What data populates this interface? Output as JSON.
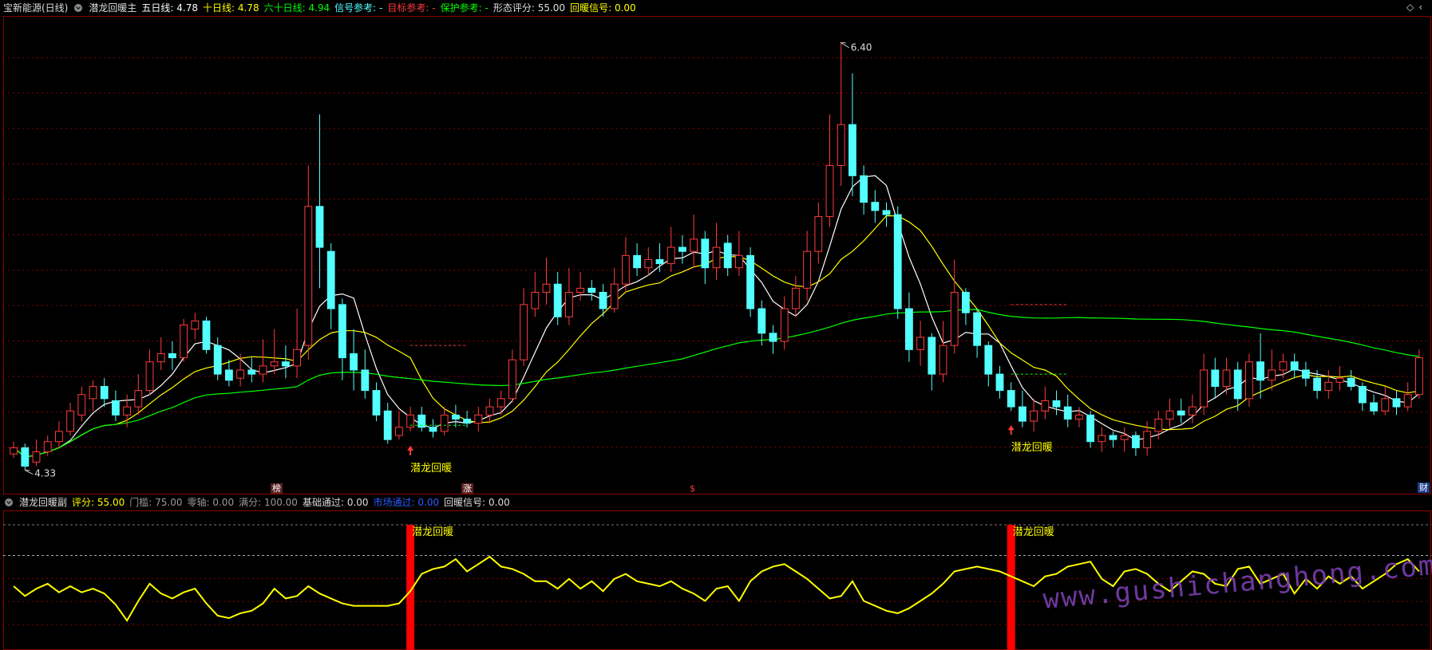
{
  "main_header": {
    "stock": "宝新能源(日线)",
    "indicator": "潜龙回暖主",
    "ma5_label": "五日线:",
    "ma5_value": "4.78",
    "ma10_label": "十日线:",
    "ma10_value": "4.78",
    "ma60_label": "六十日线:",
    "ma60_value": "4.94",
    "signal_ref_label": "信号参考:",
    "signal_ref_value": "-",
    "target_ref_label": "目标参考:",
    "target_ref_value": "-",
    "protect_ref_label": "保护参考:",
    "protect_ref_value": "-",
    "score_label": "形态评分:",
    "score_value": "55.00",
    "signal_label": "回暖信号:",
    "signal_value": "0.00"
  },
  "sub_header": {
    "indicator": "潜龙回暖副",
    "score_label": "评分:",
    "score_value": "55.00",
    "threshold_label": "门槛:",
    "threshold_value": "75.00",
    "zero_label": "零轴:",
    "zero_value": "0.00",
    "full_label": "满分:",
    "full_value": "100.00",
    "basic_label": "基础通过:",
    "basic_value": "0.00",
    "market_label": "市场通过:",
    "market_value": "0.00",
    "signal_label": "回暖信号:",
    "signal_value": "0.00"
  },
  "markers": {
    "bang": "榜",
    "zhang": "涨",
    "s": "$",
    "cai": "财"
  },
  "watermark": "www.gushichanghong.com",
  "colors": {
    "up": "#ff3b3b",
    "down": "#54ffff",
    "ma5": "#ffffff",
    "ma10": "#ffff00",
    "ma60": "#00ff00",
    "grid": "#8b0000",
    "osc": "#ffff00",
    "signal_bar": "#ff0000",
    "label_yellow": "#ffff00"
  },
  "chart_data": [
    {
      "type": "candlestick",
      "title": "宝新能源(日线)",
      "ylim": [
        4.25,
        6.5
      ],
      "price_labels": [
        "6.40",
        "4.33"
      ],
      "high_price": 6.4,
      "low_price": 4.33,
      "signal_label": "潜龙回暖",
      "signals": [
        {
          "index": 35,
          "label": "潜龙回暖",
          "target": 4.92,
          "protect": 4.53
        },
        {
          "index": 88,
          "label": "潜龙回暖",
          "target": 5.12,
          "protect": 4.78
        }
      ],
      "candles": [
        [
          4.39,
          4.42,
          4.37,
          4.45
        ],
        [
          4.42,
          4.33,
          4.31,
          4.44
        ],
        [
          4.35,
          4.4,
          4.33,
          4.46
        ],
        [
          4.4,
          4.45,
          4.38,
          4.48
        ],
        [
          4.45,
          4.5,
          4.42,
          4.55
        ],
        [
          4.5,
          4.6,
          4.48,
          4.64
        ],
        [
          4.58,
          4.68,
          4.55,
          4.72
        ],
        [
          4.66,
          4.72,
          4.6,
          4.75
        ],
        [
          4.72,
          4.66,
          4.62,
          4.76
        ],
        [
          4.65,
          4.58,
          4.55,
          4.7
        ],
        [
          4.58,
          4.62,
          4.52,
          4.68
        ],
        [
          4.62,
          4.7,
          4.58,
          4.78
        ],
        [
          4.7,
          4.84,
          4.68,
          4.9
        ],
        [
          4.84,
          4.88,
          4.8,
          4.96
        ],
        [
          4.88,
          4.86,
          4.8,
          4.94
        ],
        [
          4.86,
          5.02,
          4.84,
          5.05
        ],
        [
          5.0,
          5.04,
          4.95,
          5.08
        ],
        [
          5.04,
          4.9,
          4.88,
          5.06
        ],
        [
          4.92,
          4.78,
          4.75,
          4.96
        ],
        [
          4.8,
          4.75,
          4.72,
          4.85
        ],
        [
          4.76,
          4.8,
          4.72,
          4.88
        ],
        [
          4.8,
          4.78,
          4.74,
          4.86
        ],
        [
          4.78,
          4.82,
          4.74,
          4.95
        ],
        [
          4.82,
          4.84,
          4.78,
          5.0
        ],
        [
          4.84,
          4.82,
          4.76,
          4.92
        ],
        [
          4.82,
          4.9,
          4.76,
          5.1
        ],
        [
          4.92,
          5.6,
          4.85,
          5.8
        ],
        [
          5.6,
          5.4,
          5.2,
          6.05
        ],
        [
          5.38,
          5.1,
          5.0,
          5.42
        ],
        [
          5.12,
          4.86,
          4.75,
          5.15
        ],
        [
          4.88,
          4.8,
          4.7,
          5.0
        ],
        [
          4.8,
          4.7,
          4.66,
          4.9
        ],
        [
          4.7,
          4.58,
          4.55,
          4.74
        ],
        [
          4.6,
          4.46,
          4.44,
          4.64
        ],
        [
          4.48,
          4.52,
          4.46,
          4.6
        ],
        [
          4.52,
          4.58,
          4.5,
          4.62
        ],
        [
          4.58,
          4.52,
          4.5,
          4.62
        ],
        [
          4.52,
          4.5,
          4.47,
          4.56
        ],
        [
          4.5,
          4.58,
          4.48,
          4.62
        ],
        [
          4.58,
          4.56,
          4.52,
          4.63
        ],
        [
          4.56,
          4.54,
          4.52,
          4.6
        ],
        [
          4.54,
          4.58,
          4.5,
          4.62
        ],
        [
          4.58,
          4.62,
          4.54,
          4.66
        ],
        [
          4.62,
          4.66,
          4.58,
          4.7
        ],
        [
          4.66,
          4.85,
          4.64,
          4.9
        ],
        [
          4.85,
          5.12,
          4.82,
          5.2
        ],
        [
          5.1,
          5.18,
          5.06,
          5.28
        ],
        [
          5.18,
          5.22,
          5.12,
          5.35
        ],
        [
          5.22,
          5.06,
          5.02,
          5.28
        ],
        [
          5.06,
          5.18,
          5.02,
          5.3
        ],
        [
          5.18,
          5.2,
          5.14,
          5.28
        ],
        [
          5.2,
          5.18,
          5.14,
          5.24
        ],
        [
          5.18,
          5.1,
          5.06,
          5.22
        ],
        [
          5.1,
          5.22,
          5.08,
          5.3
        ],
        [
          5.22,
          5.36,
          5.18,
          5.45
        ],
        [
          5.36,
          5.3,
          5.26,
          5.42
        ],
        [
          5.3,
          5.34,
          5.26,
          5.4
        ],
        [
          5.34,
          5.32,
          5.28,
          5.42
        ],
        [
          5.32,
          5.4,
          5.28,
          5.5
        ],
        [
          5.4,
          5.38,
          5.32,
          5.46
        ],
        [
          5.38,
          5.44,
          5.3,
          5.56
        ],
        [
          5.44,
          5.3,
          5.22,
          5.48
        ],
        [
          5.3,
          5.4,
          5.24,
          5.52
        ],
        [
          5.42,
          5.3,
          5.26,
          5.46
        ],
        [
          5.3,
          5.36,
          5.26,
          5.48
        ],
        [
          5.36,
          5.1,
          5.06,
          5.4
        ],
        [
          5.1,
          4.98,
          4.92,
          5.14
        ],
        [
          4.98,
          4.94,
          4.88,
          5.02
        ],
        [
          4.94,
          5.1,
          4.9,
          5.16
        ],
        [
          5.1,
          5.2,
          5.06,
          5.26
        ],
        [
          5.2,
          5.38,
          5.14,
          5.48
        ],
        [
          5.38,
          5.55,
          5.32,
          5.62
        ],
        [
          5.55,
          5.8,
          5.5,
          6.05
        ],
        [
          5.8,
          6.0,
          5.7,
          6.4
        ],
        [
          6.0,
          5.75,
          5.65,
          6.25
        ],
        [
          5.75,
          5.62,
          5.56,
          5.8
        ],
        [
          5.62,
          5.58,
          5.52,
          5.68
        ],
        [
          5.58,
          5.56,
          5.5,
          5.62
        ],
        [
          5.56,
          5.1,
          5.05,
          5.6
        ],
        [
          5.1,
          4.9,
          4.84,
          5.18
        ],
        [
          4.9,
          4.96,
          4.82,
          5.04
        ],
        [
          4.96,
          4.78,
          4.7,
          4.98
        ],
        [
          4.78,
          4.92,
          4.74,
          5.04
        ],
        [
          4.92,
          5.18,
          4.88,
          5.34
        ],
        [
          5.18,
          5.08,
          5.02,
          5.2
        ],
        [
          5.08,
          4.92,
          4.86,
          5.1
        ],
        [
          4.92,
          4.78,
          4.72,
          4.94
        ],
        [
          4.78,
          4.7,
          4.66,
          4.82
        ],
        [
          4.7,
          4.62,
          4.6,
          4.74
        ],
        [
          4.62,
          4.55,
          4.52,
          4.7
        ],
        [
          4.55,
          4.6,
          4.5,
          4.66
        ],
        [
          4.6,
          4.65,
          4.56,
          4.72
        ],
        [
          4.65,
          4.62,
          4.58,
          4.7
        ],
        [
          4.62,
          4.56,
          4.52,
          4.68
        ],
        [
          4.56,
          4.58,
          4.52,
          4.62
        ],
        [
          4.58,
          4.45,
          4.42,
          4.6
        ],
        [
          4.45,
          4.48,
          4.4,
          4.52
        ],
        [
          4.48,
          4.46,
          4.42,
          4.5
        ],
        [
          4.46,
          4.48,
          4.4,
          4.52
        ],
        [
          4.48,
          4.42,
          4.38,
          4.5
        ],
        [
          4.42,
          4.5,
          4.38,
          4.55
        ],
        [
          4.5,
          4.56,
          4.46,
          4.6
        ],
        [
          4.56,
          4.6,
          4.52,
          4.66
        ],
        [
          4.6,
          4.58,
          4.54,
          4.66
        ],
        [
          4.58,
          4.62,
          4.54,
          4.68
        ],
        [
          4.62,
          4.8,
          4.58,
          4.88
        ],
        [
          4.8,
          4.72,
          4.66,
          4.86
        ],
        [
          4.72,
          4.8,
          4.68,
          4.86
        ],
        [
          4.8,
          4.66,
          4.6,
          4.84
        ],
        [
          4.66,
          4.84,
          4.62,
          4.88
        ],
        [
          4.84,
          4.75,
          4.66,
          4.98
        ],
        [
          4.75,
          4.8,
          4.7,
          4.9
        ],
        [
          4.8,
          4.84,
          4.76,
          4.88
        ],
        [
          4.84,
          4.8,
          4.76,
          4.88
        ],
        [
          4.8,
          4.76,
          4.72,
          4.84
        ],
        [
          4.76,
          4.7,
          4.66,
          4.8
        ],
        [
          4.7,
          4.74,
          4.66,
          4.8
        ],
        [
          4.74,
          4.76,
          4.7,
          4.82
        ],
        [
          4.76,
          4.72,
          4.7,
          4.8
        ],
        [
          4.72,
          4.64,
          4.6,
          4.74
        ],
        [
          4.64,
          4.6,
          4.58,
          4.68
        ],
        [
          4.6,
          4.66,
          4.58,
          4.72
        ],
        [
          4.66,
          4.62,
          4.58,
          4.7
        ],
        [
          4.62,
          4.68,
          4.6,
          4.74
        ],
        [
          4.68,
          4.86,
          4.66,
          4.9
        ]
      ]
    },
    {
      "type": "line",
      "title": "潜龙回暖副",
      "ylim": [
        0,
        100
      ],
      "threshold": 75,
      "signal_label": "潜龙回暖",
      "signal_indices": [
        35,
        88
      ],
      "values": [
        50,
        42,
        48,
        52,
        45,
        50,
        45,
        48,
        44,
        35,
        22,
        38,
        52,
        44,
        40,
        45,
        48,
        36,
        26,
        24,
        28,
        30,
        36,
        48,
        40,
        42,
        50,
        44,
        40,
        36,
        34,
        34,
        34,
        34,
        36,
        46,
        60,
        64,
        66,
        72,
        62,
        68,
        74,
        66,
        64,
        60,
        54,
        54,
        48,
        56,
        48,
        54,
        46,
        56,
        60,
        54,
        52,
        50,
        54,
        48,
        44,
        38,
        48,
        50,
        38,
        54,
        62,
        66,
        68,
        62,
        56,
        48,
        40,
        42,
        54,
        38,
        34,
        30,
        28,
        32,
        38,
        44,
        52,
        62,
        64,
        66,
        64,
        62,
        58,
        54,
        50,
        58,
        60,
        66,
        68,
        70,
        56,
        50,
        62,
        64,
        60,
        52,
        46,
        54,
        62,
        60,
        52,
        50,
        64,
        66,
        52,
        56,
        60,
        44,
        56,
        48,
        58,
        52,
        58,
        48,
        54,
        60,
        68,
        72,
        62
      ]
    }
  ]
}
